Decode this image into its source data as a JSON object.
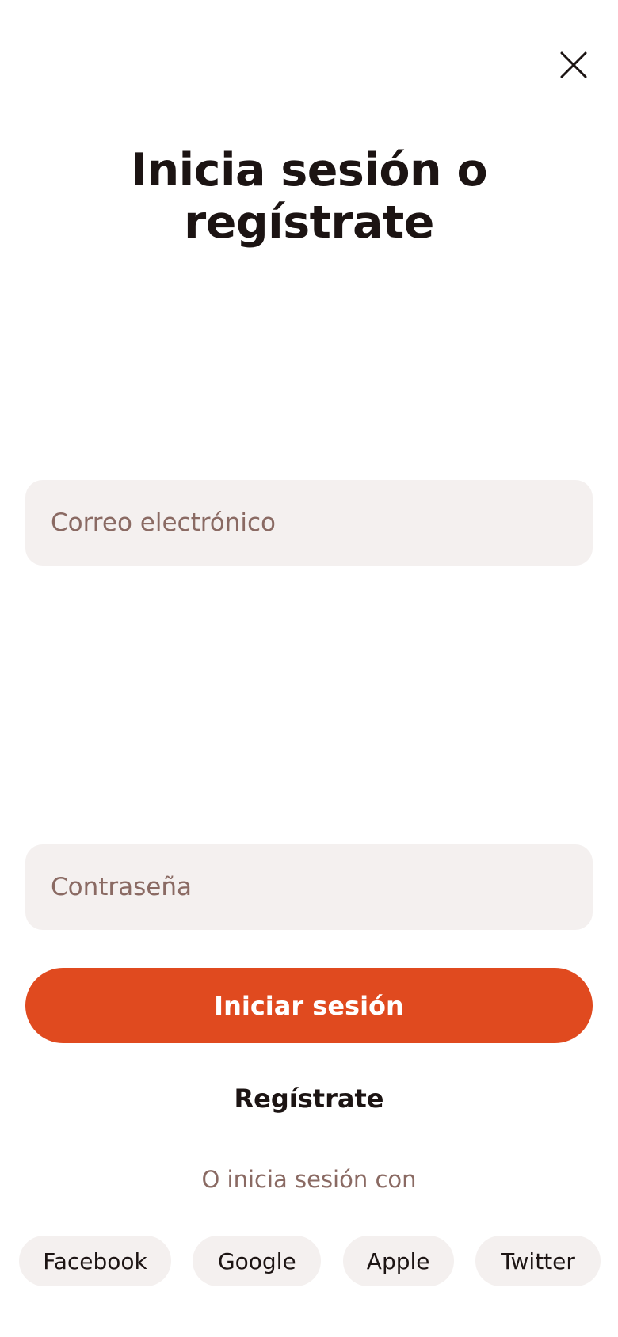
{
  "header": {
    "close_icon": "close-icon",
    "title": "Inicia sesión o regístrate"
  },
  "form": {
    "email": {
      "value": "",
      "placeholder": "Correo electrónico"
    },
    "password": {
      "value": "",
      "placeholder": "Contraseña"
    },
    "submit_label": "Iniciar sesión",
    "register_label": "Regístrate"
  },
  "social": {
    "divider_text": "O inicia sesión con",
    "providers": [
      "Facebook",
      "Google",
      "Apple",
      "Twitter"
    ]
  },
  "colors": {
    "accent": "#e04a1f",
    "field_bg": "#f4f0ef",
    "text_primary": "#1c1413",
    "text_muted": "#8a6a63"
  }
}
